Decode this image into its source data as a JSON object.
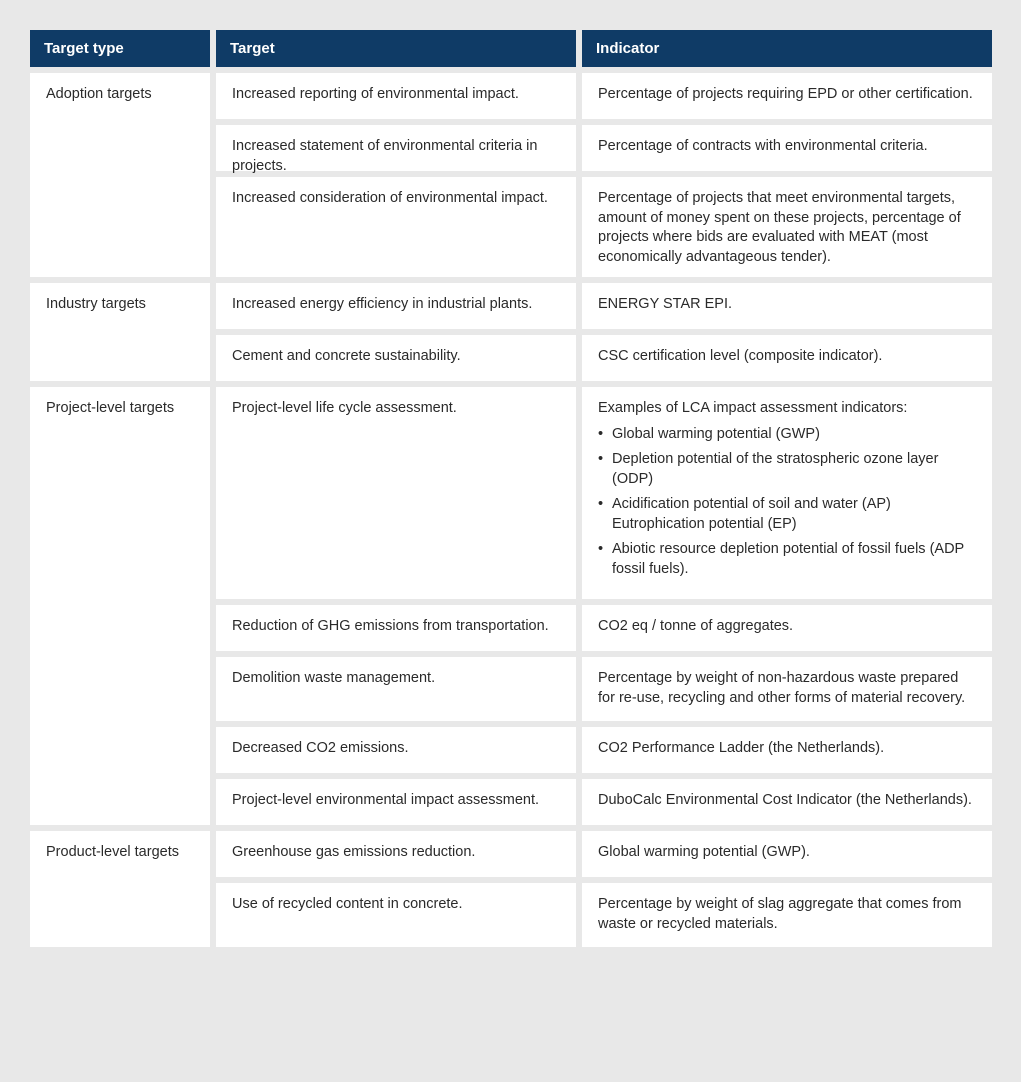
{
  "headers": {
    "type": "Target type",
    "target": "Target",
    "indicator": "Indicator"
  },
  "groups": [
    {
      "type": "Adoption targets",
      "rows": [
        {
          "target": "Increased reporting of environmental impact.",
          "indicator": "Percentage of projects requiring EPD or other certification."
        },
        {
          "target": "Increased statement of environmental criteria in projects.",
          "indicator": "Percentage of contracts with environmental criteria."
        },
        {
          "target": "Increased consideration of environmental impact.",
          "indicator": "Percentage of projects that meet environmental targets, amount of money spent on these projects, percentage of projects where bids are evaluated with MEAT (most economically advantageous tender)."
        }
      ]
    },
    {
      "type": "Industry targets",
      "rows": [
        {
          "target": "Increased energy efficiency in industrial plants.",
          "indicator": "ENERGY STAR EPI."
        },
        {
          "target": "Cement and concrete sustainability.",
          "indicator": "CSC certification level (composite indicator)."
        }
      ]
    },
    {
      "type": "Project-level targets",
      "rows": [
        {
          "target": "Project-level life cycle assessment.",
          "indicator_intro": "Examples of LCA impact assessment indicators:",
          "indicator_list": [
            "Global warming potential (GWP)",
            "Depletion potential of the stratospheric ozone layer (ODP)",
            "Acidification potential of soil and water (AP) Eutrophication potential (EP)",
            "Abiotic resource depletion potential of fossil fuels (ADP fossil fuels)."
          ]
        },
        {
          "target": "Reduction of GHG emissions from transportation.",
          "indicator": "CO2 eq / tonne of aggregates."
        },
        {
          "target": "Demolition waste management.",
          "indicator": "Percentage by weight of non-hazardous waste prepared for re-use, recycling and other forms of material recovery."
        },
        {
          "target": "Decreased CO2 emissions.",
          "indicator": "CO2 Performance Ladder (the Netherlands)."
        },
        {
          "target": "Project-level environmental impact assessment.",
          "indicator": "DuboCalc Environmental Cost Indicator (the Netherlands)."
        }
      ]
    },
    {
      "type": "Product-level targets",
      "rows": [
        {
          "target": "Greenhouse gas emissions reduction.",
          "indicator": "Global warming potential (GWP)."
        },
        {
          "target": "Use of recycled content in concrete.",
          "indicator": "Percentage by weight of slag aggregate that comes from waste or recycled materials."
        }
      ]
    }
  ],
  "heights": {
    "adoption": [
      46,
      46,
      100
    ],
    "industry": [
      46,
      46
    ],
    "project": [
      212,
      46,
      64,
      46,
      46
    ],
    "product": [
      46,
      64
    ]
  }
}
